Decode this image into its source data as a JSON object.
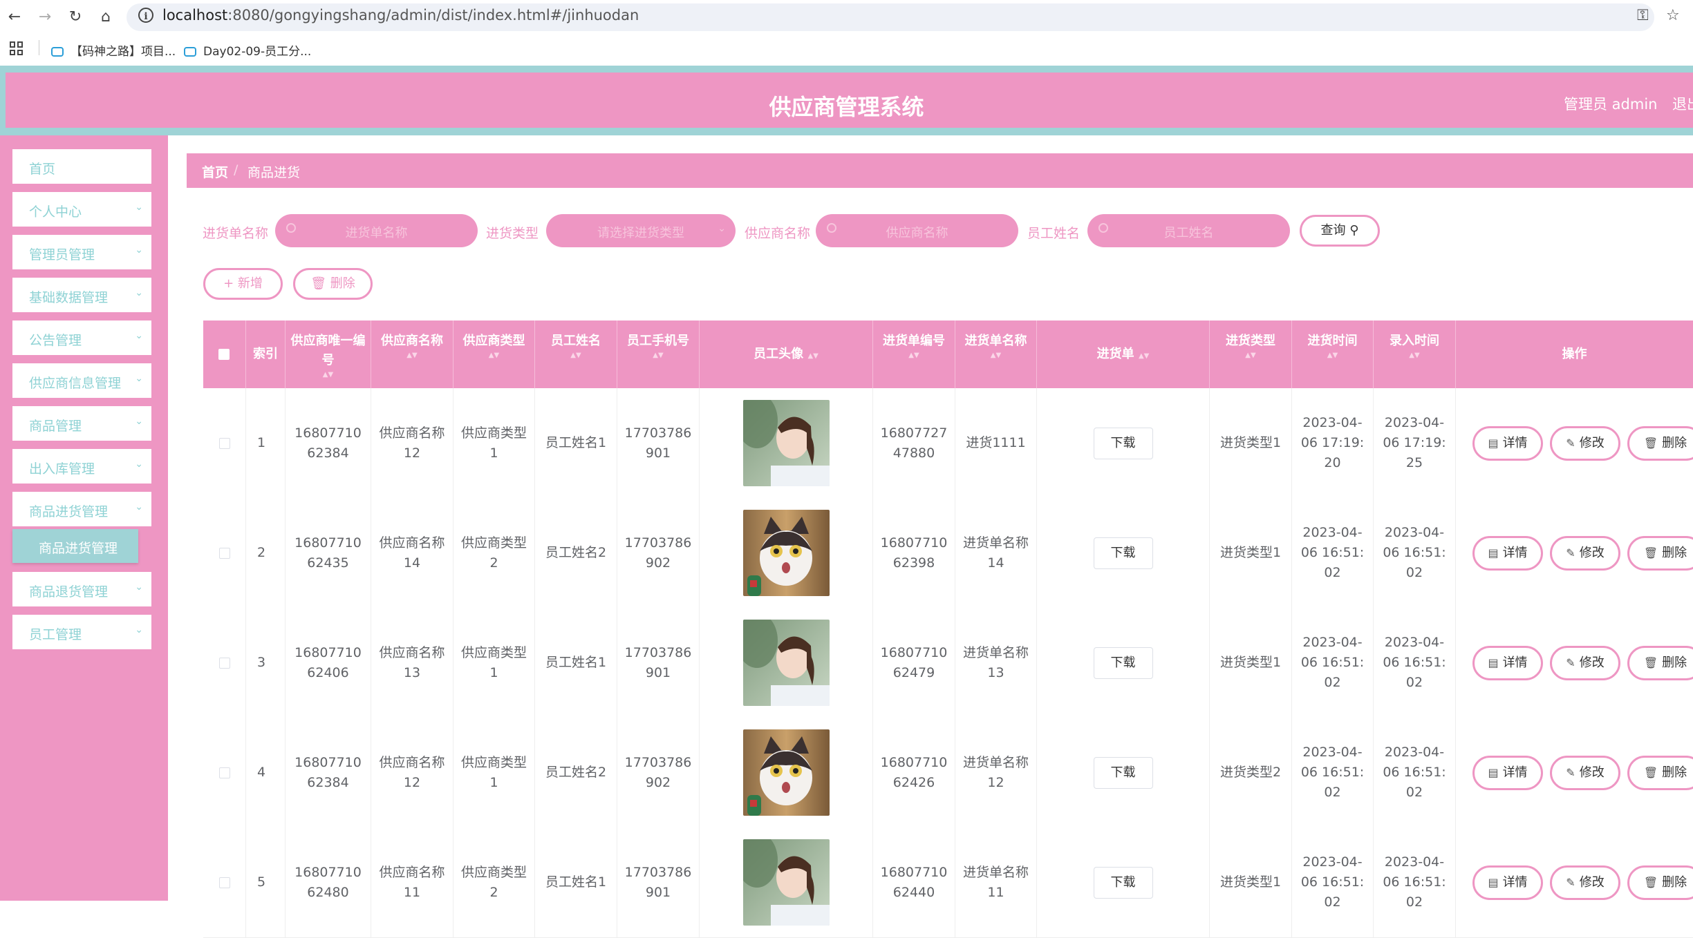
{
  "browser": {
    "url_host": "localhost",
    "url_rest": ":8080/gongyingshang/admin/dist/index.html#/jinhuodan",
    "bookmarks": [
      "【码神之路】项目...",
      "Day02-09-员工分..."
    ]
  },
  "header": {
    "title": "供应商管理系统",
    "admin": "管理员 admin",
    "logout": "退出"
  },
  "sidebar": {
    "items": [
      {
        "label": "首页"
      },
      {
        "label": "个人中心"
      },
      {
        "label": "管理员管理"
      },
      {
        "label": "基础数据管理"
      },
      {
        "label": "公告管理"
      },
      {
        "label": "供应商信息管理"
      },
      {
        "label": "商品管理"
      },
      {
        "label": "出入库管理"
      },
      {
        "label": "商品进货管理"
      },
      {
        "label": "商品退货管理"
      },
      {
        "label": "员工管理"
      }
    ],
    "submenu": "商品进货管理"
  },
  "breadcrumb": {
    "home": "首页",
    "current": "商品进货"
  },
  "filters": {
    "name_label": "进货单名称",
    "name_placeholder": "进货单名称",
    "type_label": "进货类型",
    "type_placeholder": "请选择进货类型",
    "supplier_label": "供应商名称",
    "supplier_placeholder": "供应商名称",
    "employee_label": "员工姓名",
    "employee_placeholder": "员工姓名",
    "query": "查询"
  },
  "actions": {
    "add": "新增",
    "delete": "删除"
  },
  "table": {
    "headers": [
      "索引",
      "供应商唯一编号",
      "供应商名称",
      "供应商类型",
      "员工姓名",
      "员工手机号",
      "员工头像",
      "进货单编号",
      "进货单名称",
      "进货单",
      "进货类型",
      "进货时间",
      "录入时间",
      "操作"
    ],
    "rows": [
      {
        "idx": "1",
        "code": "1680771062384",
        "name": "供应商名称12",
        "type": "供应商类型1",
        "emp": "员工姓名1",
        "phone": "17703786901",
        "avatar": "girl",
        "order_no": "1680772747880",
        "order_name": "进货1111",
        "download": "下载",
        "in_type": "进货类型1",
        "in_time": "2023-04-06 17:19:20",
        "rec_time": "2023-04-06 17:19:25"
      },
      {
        "idx": "2",
        "code": "1680771062435",
        "name": "供应商名称14",
        "type": "供应商类型2",
        "emp": "员工姓名2",
        "phone": "17703786902",
        "avatar": "cat",
        "order_no": "1680771062398",
        "order_name": "进货单名称14",
        "download": "下载",
        "in_type": "进货类型1",
        "in_time": "2023-04-06 16:51:02",
        "rec_time": "2023-04-06 16:51:02"
      },
      {
        "idx": "3",
        "code": "1680771062406",
        "name": "供应商名称13",
        "type": "供应商类型1",
        "emp": "员工姓名1",
        "phone": "17703786901",
        "avatar": "girl",
        "order_no": "1680771062479",
        "order_name": "进货单名称13",
        "download": "下载",
        "in_type": "进货类型1",
        "in_time": "2023-04-06 16:51:02",
        "rec_time": "2023-04-06 16:51:02"
      },
      {
        "idx": "4",
        "code": "1680771062384",
        "name": "供应商名称12",
        "type": "供应商类型1",
        "emp": "员工姓名2",
        "phone": "17703786902",
        "avatar": "cat",
        "order_no": "1680771062426",
        "order_name": "进货单名称12",
        "download": "下载",
        "in_type": "进货类型2",
        "in_time": "2023-04-06 16:51:02",
        "rec_time": "2023-04-06 16:51:02"
      },
      {
        "idx": "5",
        "code": "1680771062480",
        "name": "供应商名称11",
        "type": "供应商类型2",
        "emp": "员工姓名1",
        "phone": "17703786901",
        "avatar": "girl",
        "order_no": "1680771062440",
        "order_name": "进货单名称11",
        "download": "下载",
        "in_type": "进货类型1",
        "in_time": "2023-04-06 16:51:02",
        "rec_time": "2023-04-06 16:51:02"
      }
    ],
    "ops": {
      "detail": "详情",
      "edit": "修改",
      "delete": "删除"
    }
  },
  "colors": {
    "pink": "#ee96c3",
    "teal": "#9fd3d6"
  }
}
